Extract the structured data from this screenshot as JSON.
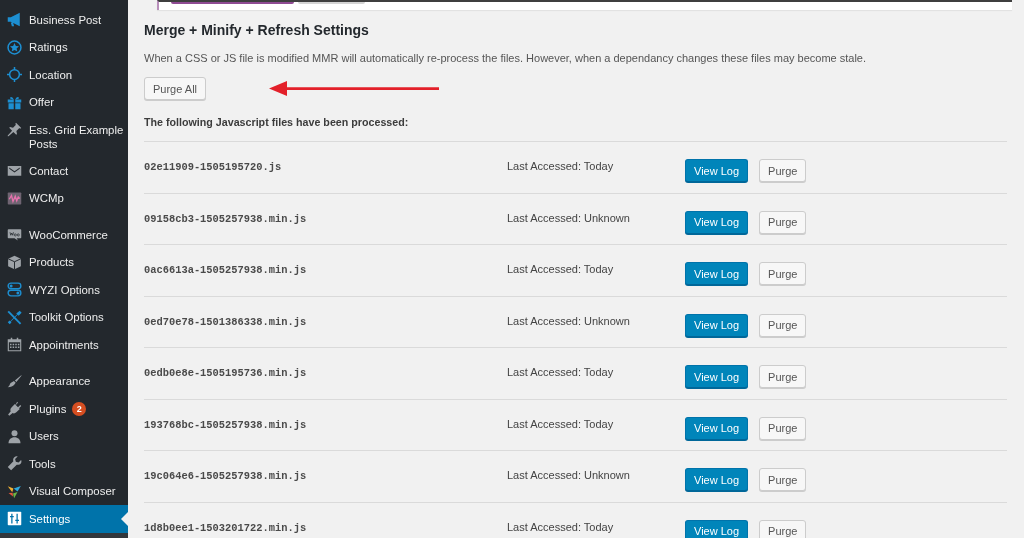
{
  "sidebar": {
    "groups": [
      {
        "items": [
          {
            "label": "Business Post",
            "selected": false
          },
          {
            "label": "Ratings",
            "selected": false
          },
          {
            "label": "Location",
            "selected": false
          },
          {
            "label": "Offer",
            "selected": false
          },
          {
            "label": "Ess. Grid Example Posts",
            "selected": false
          },
          {
            "label": "Contact",
            "selected": false
          },
          {
            "label": "WCMp",
            "selected": false
          }
        ]
      },
      {
        "items": [
          {
            "label": "WooCommerce",
            "selected": false
          },
          {
            "label": "Products",
            "selected": false
          },
          {
            "label": "WYZI Options",
            "selected": false
          },
          {
            "label": "Toolkit Options",
            "selected": false
          },
          {
            "label": "Appointments",
            "selected": false
          }
        ]
      },
      {
        "items": [
          {
            "label": "Appearance",
            "selected": false
          },
          {
            "label": "Plugins",
            "selected": false,
            "badge": "2"
          },
          {
            "label": "Users",
            "selected": false
          },
          {
            "label": "Tools",
            "selected": false
          },
          {
            "label": "Visual Composer",
            "selected": false
          },
          {
            "label": "Settings",
            "selected": true
          }
        ]
      }
    ]
  },
  "top_panel": {
    "buttons": [
      {
        "kind": "primary"
      },
      {
        "kind": "secondary"
      }
    ]
  },
  "heading": "Merge + Minify + Refresh Settings",
  "description": "When a CSS or JS file is modified MMR will automatically re-process the files. However, when a dependancy changes these files may become stale.",
  "purge_all_button": "Purge All",
  "files_heading": "The following Javascript files have been processed:",
  "files": [
    {
      "file": "02e11909-1505195720.js",
      "last_accessed": "Last Accessed: Today",
      "actions": [
        {
          "label": "View Log",
          "kind": "primary"
        },
        {
          "label": "Purge",
          "kind": "secondary"
        }
      ]
    },
    {
      "file": "09158cb3-1505257938.min.js",
      "last_accessed": "Last Accessed: Unknown",
      "actions": [
        {
          "label": "View Log",
          "kind": "primary"
        },
        {
          "label": "Purge",
          "kind": "secondary"
        }
      ]
    },
    {
      "file": "0ac6613a-1505257938.min.js",
      "last_accessed": "Last Accessed: Today",
      "actions": [
        {
          "label": "View Log",
          "kind": "primary"
        },
        {
          "label": "Purge",
          "kind": "secondary"
        }
      ]
    },
    {
      "file": "0ed70e78-1501386338.min.js",
      "last_accessed": "Last Accessed: Unknown",
      "actions": [
        {
          "label": "View Log",
          "kind": "primary"
        },
        {
          "label": "Purge",
          "kind": "secondary"
        }
      ]
    },
    {
      "file": "0edb0e8e-1505195736.min.js",
      "last_accessed": "Last Accessed: Today",
      "actions": [
        {
          "label": "View Log",
          "kind": "primary"
        },
        {
          "label": "Purge",
          "kind": "secondary"
        }
      ]
    },
    {
      "file": "193768bc-1505257938.min.js",
      "last_accessed": "Last Accessed: Today",
      "actions": [
        {
          "label": "View Log",
          "kind": "primary"
        },
        {
          "label": "Purge",
          "kind": "secondary"
        }
      ]
    },
    {
      "file": "19c064e6-1505257938.min.js",
      "last_accessed": "Last Accessed: Unknown",
      "actions": [
        {
          "label": "View Log",
          "kind": "primary"
        },
        {
          "label": "Purge",
          "kind": "secondary"
        }
      ]
    },
    {
      "file": "1d8b0ee1-1503201722.min.js",
      "last_accessed": "Last Accessed: Today",
      "actions": [
        {
          "label": "View Log",
          "kind": "primary"
        },
        {
          "label": "Purge",
          "kind": "secondary"
        }
      ]
    }
  ]
}
